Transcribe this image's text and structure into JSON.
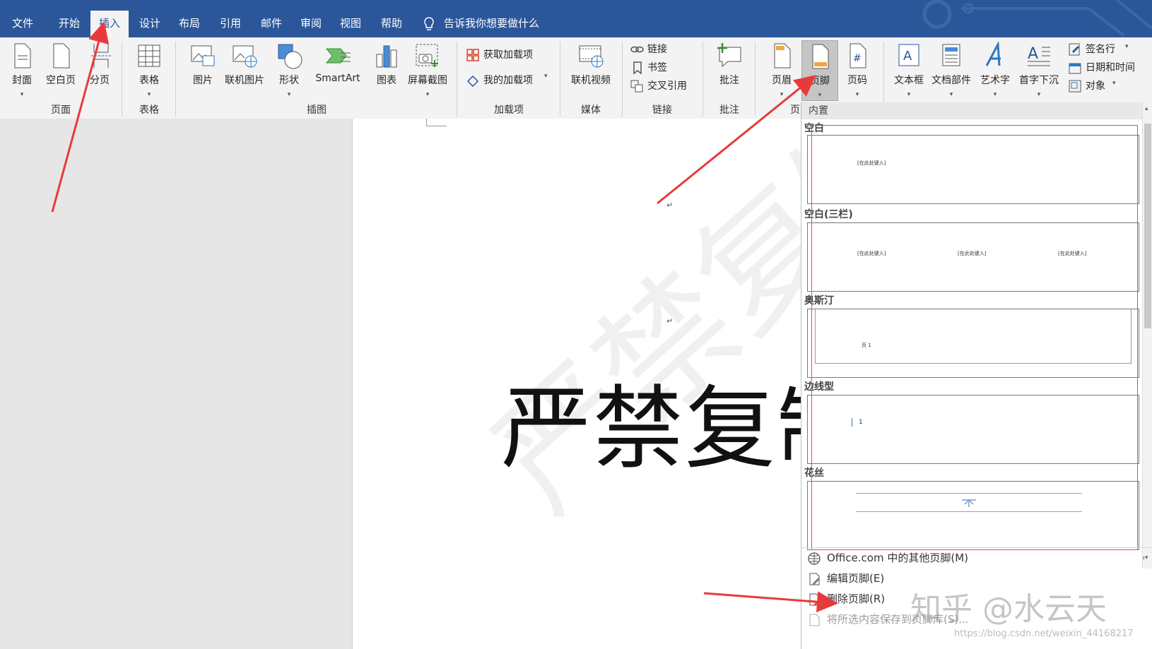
{
  "tabs": [
    {
      "label": "文件",
      "active": false
    },
    {
      "label": "开始",
      "active": false
    },
    {
      "label": "插入",
      "active": true
    },
    {
      "label": "设计",
      "active": false
    },
    {
      "label": "布局",
      "active": false
    },
    {
      "label": "引用",
      "active": false
    },
    {
      "label": "邮件",
      "active": false
    },
    {
      "label": "审阅",
      "active": false
    },
    {
      "label": "视图",
      "active": false
    },
    {
      "label": "帮助",
      "active": false
    }
  ],
  "tellme": "告诉我你想要做什么",
  "ribbon": {
    "pages": {
      "group": "页面",
      "cover": "封面",
      "blank": "空白页",
      "break": "分页"
    },
    "tables": {
      "group": "表格",
      "table": "表格"
    },
    "illustrations": {
      "group": "插图",
      "picture": "图片",
      "online_picture": "联机图片",
      "shapes": "形状",
      "smartart": "SmartArt",
      "chart": "图表",
      "screenshot": "屏幕截图"
    },
    "addins": {
      "group": "加载项",
      "get": "获取加载项",
      "my": "我的加载项"
    },
    "media": {
      "group": "媒体",
      "video": "联机视频"
    },
    "links": {
      "group": "链接",
      "link": "链接",
      "bookmark": "书签",
      "crossref": "交叉引用"
    },
    "comments": {
      "group": "批注",
      "comment": "批注"
    },
    "header_footer": {
      "group": "页",
      "header": "页眉",
      "footer": "页脚",
      "page_number": "页码"
    },
    "text": {
      "textbox": "文本框",
      "quickparts": "文档部件",
      "wordart": "艺术字",
      "dropcap": "首字下沉",
      "signature": "签名行",
      "datetime": "日期和时间",
      "object": "对象"
    }
  },
  "document": {
    "big_text": "严禁复制",
    "watermark": "严禁复制",
    "para_mark": "↵"
  },
  "gallery": {
    "section": "内置",
    "items": [
      {
        "title": "空白",
        "placeholder": "[在此处键入]"
      },
      {
        "title": "空白(三栏)",
        "placeholder": "[在此处键入]"
      },
      {
        "title": "奥斯汀",
        "placeholder": "页 1"
      },
      {
        "title": "边线型",
        "placeholder": "1"
      },
      {
        "title": "花丝",
        "placeholder": ""
      }
    ],
    "menu": [
      {
        "label": "Office.com 中的其他页脚(M)",
        "icon": "globe-icon"
      },
      {
        "label": "编辑页脚(E)",
        "icon": "edit-footer-icon"
      },
      {
        "label": "删除页脚(R)",
        "icon": "delete-footer-icon"
      },
      {
        "label": "将所选内容保存到页脚库(S)...",
        "icon": "save-footer-icon"
      }
    ]
  },
  "watermarks": {
    "zhihu": "知乎 @水云天",
    "url": "https://blog.csdn.net/weixin_44168217"
  },
  "colors": {
    "title_bar": "#2b579a",
    "ribbon": "#f3f3f3",
    "arrow": "#e83a3a"
  }
}
